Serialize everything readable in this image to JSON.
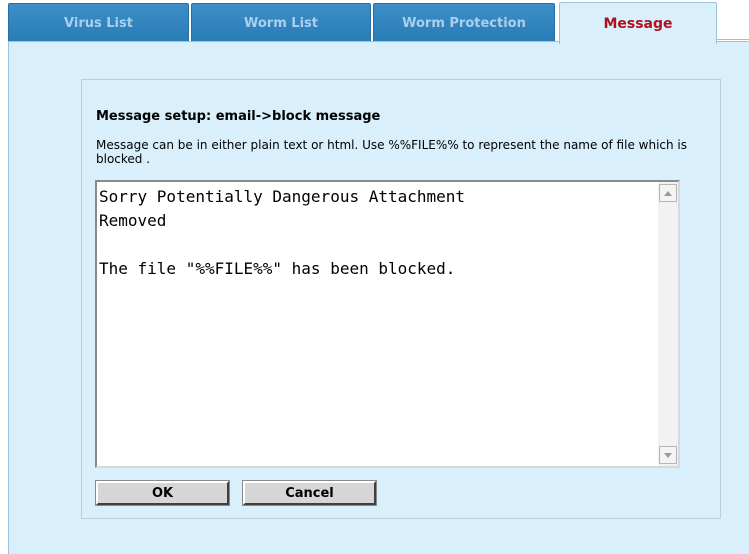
{
  "tabs": [
    {
      "label": "Virus List",
      "active": false
    },
    {
      "label": "Worm List",
      "active": false
    },
    {
      "label": "Worm Protection",
      "active": false
    },
    {
      "label": "Message",
      "active": true
    }
  ],
  "message": {
    "heading": "Message setup:  email->block message",
    "description": "Message can be in either plain text or html. Use %%FILE%% to represent the name of file which is blocked .",
    "body": "Sorry Potentially Dangerous Attachment\nRemoved\n\nThe file \"%%FILE%%\" has been blocked."
  },
  "buttons": {
    "ok_label": "OK",
    "cancel_label": "Cancel"
  },
  "colors": {
    "tab_inactive": "#2a7bb6",
    "tab_inactive_text": "#a9d0ee",
    "tab_active_text": "#b0101a",
    "panel_background": "#d9effb"
  }
}
